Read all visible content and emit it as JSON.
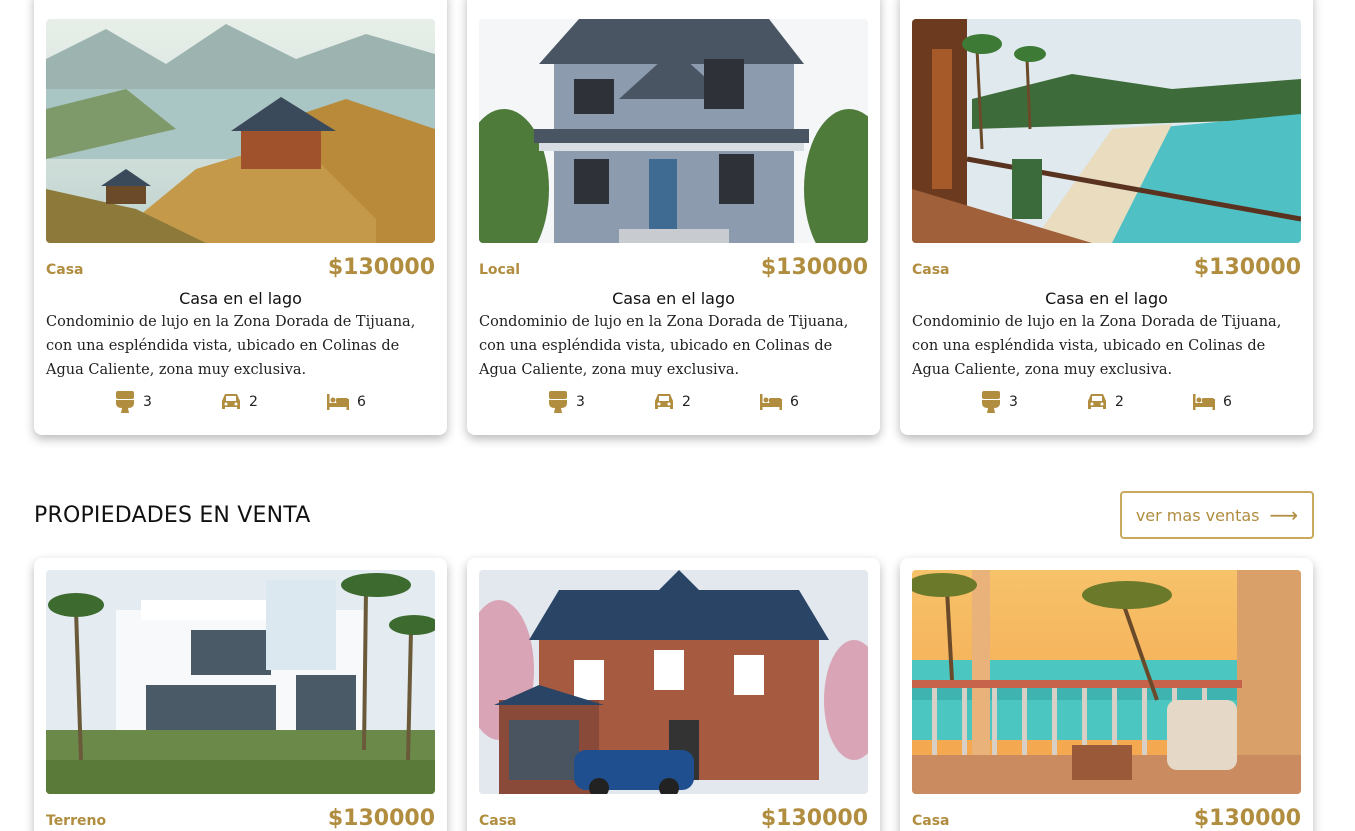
{
  "colors": {
    "accent": "#b08d3f",
    "button_border": "#c9a95c",
    "text": "#111111"
  },
  "top_listings": [
    {
      "type": "Casa",
      "price": "$130000",
      "title": "Casa en el lago",
      "description": "Condominio de lujo en la Zona Dorada de Tijuana, con una espléndida vista, ubicado en Colinas de Agua Caliente, zona muy exclusiva.",
      "bathrooms": "3",
      "parking": "2",
      "bedrooms": "6",
      "image": "mountain-lake-house"
    },
    {
      "type": "Local",
      "price": "$130000",
      "title": "Casa en el lago",
      "description": "Condominio de lujo en la Zona Dorada de Tijuana, con una espléndida vista, ubicado en Colinas de Agua Caliente, zona muy exclusiva.",
      "bathrooms": "3",
      "parking": "2",
      "bedrooms": "6",
      "image": "grey-two-story-house"
    },
    {
      "type": "Casa",
      "price": "$130000",
      "title": "Casa en el lago",
      "description": "Condominio de lujo en la Zona Dorada de Tijuana, con una espléndida vista, ubicado en Colinas de Agua Caliente, zona muy exclusiva.",
      "bathrooms": "3",
      "parking": "2",
      "bedrooms": "6",
      "image": "beach-balcony"
    }
  ],
  "sale_section": {
    "title": "PROPIEDADES EN VENTA",
    "more_label": "ver mas ventas",
    "more_icon": "arrow-right-icon"
  },
  "sale_listings": [
    {
      "type": "Terreno",
      "price": "$130000",
      "image": "modern-white-villa"
    },
    {
      "type": "Casa",
      "price": "$130000",
      "image": "brick-house-with-car"
    },
    {
      "type": "Casa",
      "price": "$130000",
      "image": "sunset-ocean-balcony"
    }
  ]
}
